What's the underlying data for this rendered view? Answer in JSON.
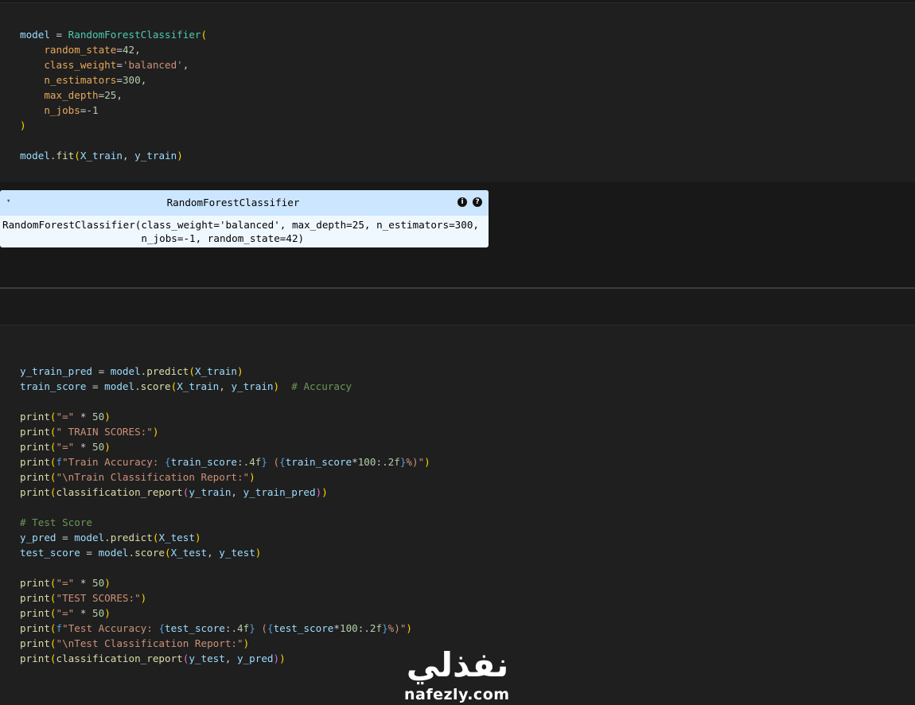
{
  "cell1": {
    "lines": [
      [
        [
          "v",
          "model"
        ],
        [
          "t",
          " = "
        ],
        [
          "c",
          "RandomForestClassifier"
        ],
        [
          "p",
          "("
        ]
      ],
      [
        [
          "t",
          "    "
        ],
        [
          "pr",
          "random_state"
        ],
        [
          "t",
          "="
        ],
        [
          "n",
          "42"
        ],
        [
          "t",
          ","
        ]
      ],
      [
        [
          "t",
          "    "
        ],
        [
          "pr",
          "class_weight"
        ],
        [
          "t",
          "="
        ],
        [
          "s",
          "'balanced'"
        ],
        [
          "t",
          ","
        ]
      ],
      [
        [
          "t",
          "    "
        ],
        [
          "pr",
          "n_estimators"
        ],
        [
          "t",
          "="
        ],
        [
          "n",
          "300"
        ],
        [
          "t",
          ","
        ]
      ],
      [
        [
          "t",
          "    "
        ],
        [
          "pr",
          "max_depth"
        ],
        [
          "t",
          "="
        ],
        [
          "n",
          "25"
        ],
        [
          "t",
          ","
        ]
      ],
      [
        [
          "t",
          "    "
        ],
        [
          "pr",
          "n_jobs"
        ],
        [
          "t",
          "=-"
        ],
        [
          "n",
          "1"
        ]
      ],
      [
        [
          "p",
          ")"
        ]
      ],
      [
        [
          "t",
          ""
        ]
      ],
      [
        [
          "v",
          "model"
        ],
        [
          "t",
          "."
        ],
        [
          "f",
          "fit"
        ],
        [
          "p",
          "("
        ],
        [
          "v",
          "X_train"
        ],
        [
          "t",
          ", "
        ],
        [
          "v",
          "y_train"
        ],
        [
          "p",
          ")"
        ]
      ]
    ]
  },
  "estimator": {
    "toggle": "▾",
    "title": "RandomForestClassifier",
    "info_icon": "i",
    "help_icon": "?",
    "repr_line1": "RandomForestClassifier(class_weight='balanced', max_depth=25, n_estimators=300,",
    "repr_line2": "                       n_jobs=-1, random_state=42)"
  },
  "cell2": {
    "lines": [
      [
        [
          "v",
          "y_train_pred"
        ],
        [
          "t",
          " = "
        ],
        [
          "v",
          "model"
        ],
        [
          "t",
          "."
        ],
        [
          "f",
          "predict"
        ],
        [
          "p",
          "("
        ],
        [
          "v",
          "X_train"
        ],
        [
          "p",
          ")"
        ]
      ],
      [
        [
          "v",
          "train_score"
        ],
        [
          "t",
          " = "
        ],
        [
          "v",
          "model"
        ],
        [
          "t",
          "."
        ],
        [
          "f",
          "score"
        ],
        [
          "p",
          "("
        ],
        [
          "v",
          "X_train"
        ],
        [
          "t",
          ", "
        ],
        [
          "v",
          "y_train"
        ],
        [
          "p",
          ")"
        ],
        [
          "t",
          "  "
        ],
        [
          "cm",
          "# Accuracy"
        ]
      ],
      [
        [
          "t",
          ""
        ]
      ],
      [
        [
          "f",
          "print"
        ],
        [
          "p",
          "("
        ],
        [
          "s",
          "\"=\""
        ],
        [
          "t",
          " * "
        ],
        [
          "n",
          "50"
        ],
        [
          "p",
          ")"
        ]
      ],
      [
        [
          "f",
          "print"
        ],
        [
          "p",
          "("
        ],
        [
          "s",
          "\" TRAIN SCORES:\""
        ],
        [
          "p",
          ")"
        ]
      ],
      [
        [
          "f",
          "print"
        ],
        [
          "p",
          "("
        ],
        [
          "s",
          "\"=\""
        ],
        [
          "t",
          " * "
        ],
        [
          "n",
          "50"
        ],
        [
          "p",
          ")"
        ]
      ],
      [
        [
          "f",
          "print"
        ],
        [
          "p",
          "("
        ],
        [
          "k",
          "f"
        ],
        [
          "s",
          "\"Train Accuracy: "
        ],
        [
          "k",
          "{"
        ],
        [
          "v",
          "train_score"
        ],
        [
          "t",
          ":"
        ],
        [
          "n",
          ".4f"
        ],
        [
          "k",
          "}"
        ],
        [
          "s",
          " ("
        ],
        [
          "k",
          "{"
        ],
        [
          "v",
          "train_score"
        ],
        [
          "t",
          "*"
        ],
        [
          "n",
          "100"
        ],
        [
          "t",
          ":"
        ],
        [
          "n",
          ".2f"
        ],
        [
          "k",
          "}"
        ],
        [
          "s",
          "%)\""
        ],
        [
          "p",
          ")"
        ]
      ],
      [
        [
          "f",
          "print"
        ],
        [
          "p",
          "("
        ],
        [
          "s",
          "\"\\nTrain Classification Report:\""
        ],
        [
          "p",
          ")"
        ]
      ],
      [
        [
          "f",
          "print"
        ],
        [
          "p",
          "("
        ],
        [
          "f",
          "classification_report"
        ],
        [
          "br",
          "("
        ],
        [
          "v",
          "y_train"
        ],
        [
          "t",
          ", "
        ],
        [
          "v",
          "y_train_pred"
        ],
        [
          "br",
          ")"
        ],
        [
          "p",
          ")"
        ]
      ],
      [
        [
          "t",
          ""
        ]
      ],
      [
        [
          "cm",
          "# Test Score"
        ]
      ],
      [
        [
          "v",
          "y_pred"
        ],
        [
          "t",
          " = "
        ],
        [
          "v",
          "model"
        ],
        [
          "t",
          "."
        ],
        [
          "f",
          "predict"
        ],
        [
          "p",
          "("
        ],
        [
          "v",
          "X_test"
        ],
        [
          "p",
          ")"
        ]
      ],
      [
        [
          "v",
          "test_score"
        ],
        [
          "t",
          " = "
        ],
        [
          "v",
          "model"
        ],
        [
          "t",
          "."
        ],
        [
          "f",
          "score"
        ],
        [
          "p",
          "("
        ],
        [
          "v",
          "X_test"
        ],
        [
          "t",
          ", "
        ],
        [
          "v",
          "y_test"
        ],
        [
          "p",
          ")"
        ]
      ],
      [
        [
          "t",
          ""
        ]
      ],
      [
        [
          "f",
          "print"
        ],
        [
          "p",
          "("
        ],
        [
          "s",
          "\"=\""
        ],
        [
          "t",
          " * "
        ],
        [
          "n",
          "50"
        ],
        [
          "p",
          ")"
        ]
      ],
      [
        [
          "f",
          "print"
        ],
        [
          "p",
          "("
        ],
        [
          "s",
          "\"TEST SCORES:\""
        ],
        [
          "p",
          ")"
        ]
      ],
      [
        [
          "f",
          "print"
        ],
        [
          "p",
          "("
        ],
        [
          "s",
          "\"=\""
        ],
        [
          "t",
          " * "
        ],
        [
          "n",
          "50"
        ],
        [
          "p",
          ")"
        ]
      ],
      [
        [
          "f",
          "print"
        ],
        [
          "p",
          "("
        ],
        [
          "k",
          "f"
        ],
        [
          "s",
          "\"Test Accuracy: "
        ],
        [
          "k",
          "{"
        ],
        [
          "v",
          "test_score"
        ],
        [
          "t",
          ":"
        ],
        [
          "n",
          ".4f"
        ],
        [
          "k",
          "}"
        ],
        [
          "s",
          " ("
        ],
        [
          "k",
          "{"
        ],
        [
          "v",
          "test_score"
        ],
        [
          "t",
          "*"
        ],
        [
          "n",
          "100"
        ],
        [
          "t",
          ":"
        ],
        [
          "n",
          ".2f"
        ],
        [
          "k",
          "}"
        ],
        [
          "s",
          "%)\""
        ],
        [
          "p",
          ")"
        ]
      ],
      [
        [
          "f",
          "print"
        ],
        [
          "p",
          "("
        ],
        [
          "s",
          "\"\\nTest Classification Report:\""
        ],
        [
          "p",
          ")"
        ]
      ],
      [
        [
          "f",
          "print"
        ],
        [
          "p",
          "("
        ],
        [
          "f",
          "classification_report"
        ],
        [
          "br",
          "("
        ],
        [
          "v",
          "y_test"
        ],
        [
          "t",
          ", "
        ],
        [
          "v",
          "y_pred"
        ],
        [
          "br",
          ")"
        ],
        [
          "p",
          ")"
        ]
      ]
    ]
  },
  "watermark": {
    "logo_text": "نفذلي",
    "domain": "nafezly.com"
  }
}
